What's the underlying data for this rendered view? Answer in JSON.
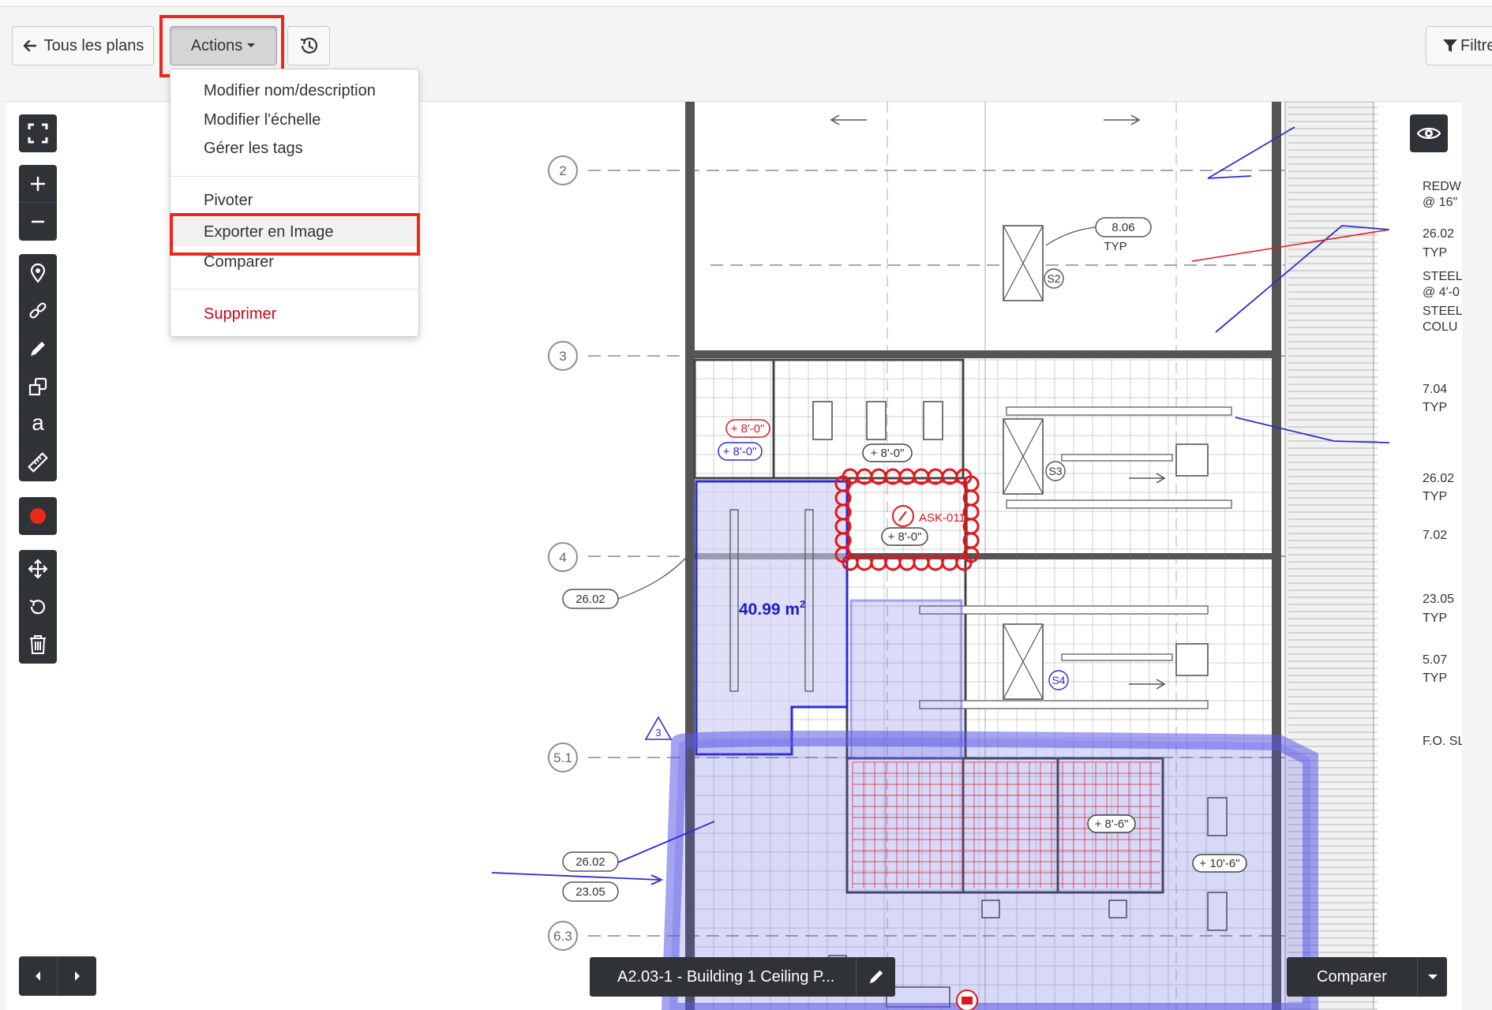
{
  "header": {
    "back_label": "Tous les plans",
    "actions_label": "Actions",
    "filter_label": "Filtre"
  },
  "actions_menu": {
    "items": [
      {
        "label": "Modifier nom/description"
      },
      {
        "label": "Modifier l'échelle"
      },
      {
        "label": "Gérer les tags"
      },
      {
        "label": "Pivoter"
      },
      {
        "label": "Exporter en Image"
      },
      {
        "label": "Comparer"
      },
      {
        "label": "Supprimer"
      }
    ]
  },
  "toolbar": {
    "tools": [
      "fullscreen-icon",
      "zoom-in-icon",
      "zoom-out-icon",
      "pin-icon",
      "link-icon",
      "pencil-icon",
      "shapes-icon",
      "text-icon",
      "ruler-icon",
      "record-icon",
      "move-icon",
      "rotate-icon",
      "trash-icon"
    ],
    "text_tool_glyph": "a",
    "record_color": "#e8291c"
  },
  "plan": {
    "grid_labels": [
      "2",
      "3",
      "4",
      "5.1",
      "6.3"
    ],
    "tags": [
      "8.06",
      "TYP",
      "26.02",
      "26.02",
      "23.05"
    ],
    "area_label": "40.99 m",
    "area_unit_sup": "2",
    "issue_label": "ASK-011",
    "ceiling_heights": [
      "+ 8'-0\"",
      "+ 8'-0\"",
      "+ 8'-0\"",
      "+ 8'-0\"",
      "+ 8'-6\"",
      "+ 10'-6\""
    ],
    "right_notes": [
      "REDW",
      "@ 16\"",
      "26.02",
      "TYP",
      "STEEL",
      "@ 4'-0",
      "STEEL",
      "COLU",
      "7.04",
      "TYP",
      "26.02",
      "TYP",
      "7.02",
      "23.05",
      "TYP",
      "5.07",
      "TYP",
      "F.O. SL"
    ],
    "symbols": [
      "S2",
      "S3",
      "S4"
    ],
    "revision_mark": "3"
  },
  "bottom": {
    "sheet_name": "A2.03-1 - Building 1 Ceiling P...",
    "compare_label": "Comparer"
  },
  "colors": {
    "highlight": "#e8291c",
    "toolbar_bg": "#2f3237",
    "markup_blue": "#2b2bd6",
    "markup_red": "#e0161f",
    "danger_text": "#d0021b"
  }
}
